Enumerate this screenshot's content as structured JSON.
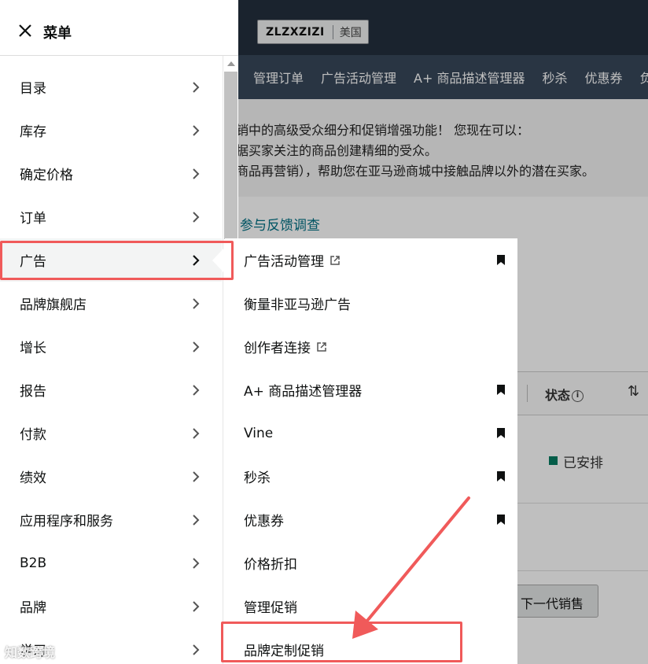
{
  "background": {
    "store_name": "ZLZXZIZI",
    "store_country": "美国",
    "nav_tabs": [
      "管理订单",
      "广告活动管理",
      "A+ 商品描述管理器",
      "秒杀",
      "优惠券",
      "负"
    ],
    "banner_lines": [
      "销中的高级受众细分和促销增强功能！ 您现在可以：",
      "据买家关注的商品创建精细的受众。",
      "商品再营销），帮助您在亚马逊商城中接触品牌以外的潜在买家。"
    ],
    "feedback_link": "参与反馈调查",
    "status_header": "状态",
    "status_value": "已安排",
    "next_button": "下一代销售"
  },
  "menu": {
    "title": "菜单",
    "items": [
      {
        "label": "目录"
      },
      {
        "label": "库存"
      },
      {
        "label": "确定价格"
      },
      {
        "label": "订单"
      },
      {
        "label": "广告"
      },
      {
        "label": "品牌旗舰店"
      },
      {
        "label": "增长"
      },
      {
        "label": "报告"
      },
      {
        "label": "付款"
      },
      {
        "label": "绩效"
      },
      {
        "label": "应用程序和服务"
      },
      {
        "label": "B2B"
      },
      {
        "label": "品牌"
      },
      {
        "label": "学习"
      }
    ]
  },
  "submenu": {
    "items": [
      {
        "label": "广告活动管理",
        "external": true,
        "bookmarked": true
      },
      {
        "label": "衡量非亚马逊广告",
        "external": false,
        "bookmarked": false
      },
      {
        "label": "创作者连接",
        "external": true,
        "bookmarked": false
      },
      {
        "label": "A+ 商品描述管理器",
        "external": false,
        "bookmarked": true
      },
      {
        "label": "Vine",
        "external": false,
        "bookmarked": true
      },
      {
        "label": "秒杀",
        "external": false,
        "bookmarked": true
      },
      {
        "label": "优惠券",
        "external": false,
        "bookmarked": true
      },
      {
        "label": "价格折扣",
        "external": false,
        "bookmarked": false
      },
      {
        "label": "管理促销",
        "external": false,
        "bookmarked": false
      },
      {
        "label": "品牌定制促销",
        "external": false,
        "bookmarked": false
      }
    ]
  },
  "watermark": "知数跨境",
  "colors": {
    "highlight": "#f05a5a",
    "topbar": "#232f3e",
    "navbar": "#37475a"
  }
}
